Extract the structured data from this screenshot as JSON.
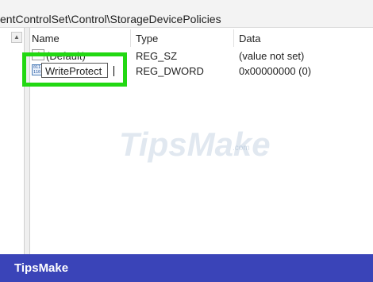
{
  "path_bar": {
    "text": "entControlSet\\Control\\StorageDevicePolicies"
  },
  "list": {
    "columns": {
      "name": "Name",
      "type": "Type",
      "data": "Data"
    },
    "rows": [
      {
        "icon": "string-value-icon",
        "icon_glyph": "ab",
        "name": "(Default)",
        "type": "REG_SZ",
        "data": "(value not set)"
      },
      {
        "icon": "dword-value-icon",
        "icon_glyph": "011 110",
        "name": "WriteProtect",
        "type": "REG_DWORD",
        "data": "0x00000000 (0)",
        "editing": true
      }
    ]
  },
  "scroll_up_glyph": "▲",
  "watermark": {
    "text": "TipsMake",
    "sub": ".com"
  },
  "footer": {
    "brand": "TipsMake"
  },
  "colors": {
    "highlight": "#22d812",
    "footer_bg": "#3a44b8"
  }
}
